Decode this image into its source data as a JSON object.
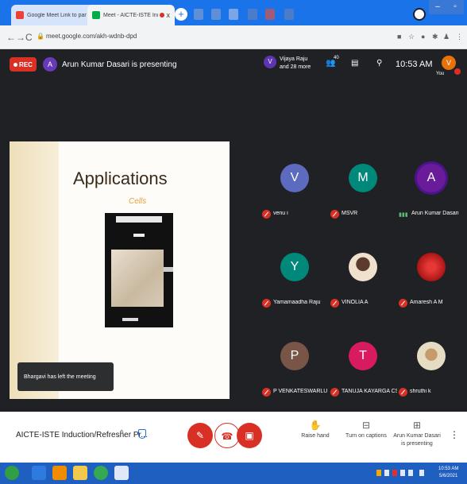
{
  "browser": {
    "tabs": [
      {
        "title": "Google Meet Link to participants",
        "close": "x"
      },
      {
        "title": "Meet - AICTE-ISTE Induction",
        "close": "x"
      }
    ],
    "new_tab": "+",
    "url": "meet.google.com/akh-wdnb-dpd"
  },
  "meet": {
    "rec_label": "REC",
    "presenter": {
      "initial": "A",
      "text": "Arun Kumar Dasari is presenting"
    },
    "participants_chip": {
      "initial": "V",
      "line1": "Vijaya Raju",
      "line2": "and 28 more"
    },
    "people_count": "40",
    "time": "10:53 AM",
    "self": {
      "initial": "V",
      "label": "You"
    },
    "slide": {
      "title": "Applications",
      "annotation": "Cells"
    },
    "toast": "Bhargavi has left the meeting",
    "tiles": [
      {
        "name": "venu i",
        "initial": "V",
        "color": "#5c6bc0",
        "status": "muted"
      },
      {
        "name": "MSVR",
        "initial": "M",
        "color": "#00897b",
        "status": "muted"
      },
      {
        "name": "Arun Kumar Dasari",
        "initial": "A",
        "color": "#6a1b9a",
        "status": "speaking"
      },
      {
        "name": "Yamamaadha Raju",
        "initial": "Y",
        "color": "#00897b",
        "status": "muted"
      },
      {
        "name": "VINOLIA A",
        "initial": "",
        "color": "#f5e6d3",
        "status": "muted",
        "photo": true
      },
      {
        "name": "Amaresh A M",
        "initial": "",
        "color": "#c62828",
        "status": "muted",
        "photo": true
      },
      {
        "name": "P VENKATESWARLU IT,...",
        "initial": "P",
        "color": "#795548",
        "status": "muted"
      },
      {
        "name": "TANUJA KAYARGA CS...",
        "initial": "T",
        "color": "#d81b60",
        "status": "muted"
      },
      {
        "name": "shruthi k",
        "initial": "",
        "color": "#e0d7c2",
        "status": "muted",
        "photo": true
      }
    ],
    "bottom": {
      "meeting_title": "AICTE-ISTE Induction/Refresher Pr...",
      "raise_hand": "Raise hand",
      "captions": "Turn on captions",
      "presenting_line1": "Arun Kumar Dasari",
      "presenting_line2": "is presenting"
    }
  },
  "taskbar": {
    "time": "10:53 AM",
    "date": "5/6/2021"
  }
}
